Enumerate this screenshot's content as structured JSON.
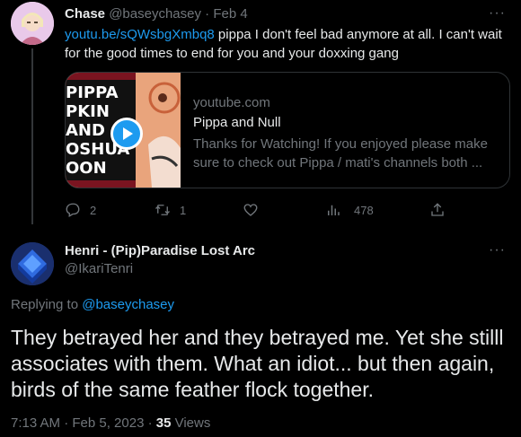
{
  "original_tweet": {
    "display_name": "Chase",
    "handle": "@baseychasey",
    "separator": " · ",
    "date": "Feb 4",
    "more_label": "···",
    "link_text": "youtu.be/sQWsbgXmbq8",
    "text": " pippa I don't feel bad anymore at all. I can't wait for the good times to end for you and your doxxing gang",
    "card": {
      "thumb_lines": [
        "PIPPA",
        "PKIN",
        "AND",
        "OSHUA",
        "OON"
      ],
      "domain": "youtube.com",
      "title": "Pippa and Null",
      "description": "Thanks for Watching! If you enjoyed please make sure to check out Pippa / mati's channels both ..."
    },
    "actions": {
      "replies": "2",
      "retweets": "1",
      "likes": "",
      "views": "478"
    },
    "icons": [
      "reply-icon",
      "retweet-icon",
      "like-icon",
      "views-icon",
      "share-icon",
      "play-icon",
      "more-icon"
    ]
  },
  "reply_tweet": {
    "display_name": "Henri - (Pip)Paradise Lost Arc",
    "handle": "@IkariTenri",
    "more_label": "···",
    "replying_prefix": "Replying to ",
    "replying_to": "@baseychasey",
    "text": "They betrayed her and they betrayed me. Yet she stilll associates with them. What an idiot... but then again, birds of the same feather flock together.",
    "time": "7:13 AM · Feb 5, 2023 · ",
    "views_count": "35",
    "views_label": " Views"
  },
  "colors": {
    "background": "#000000",
    "text": "#e7e9ea",
    "muted": "#71767b",
    "accent": "#1d9bf0",
    "border": "#2f3336"
  }
}
